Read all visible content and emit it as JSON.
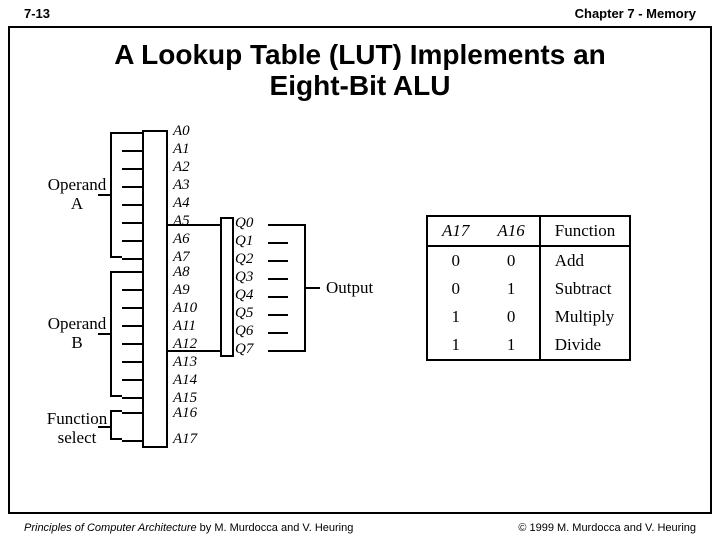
{
  "header": {
    "page_num": "7-13",
    "chapter": "Chapter 7 - Memory"
  },
  "title_line1": "A Lookup Table (LUT) Implements an",
  "title_line2": "Eight-Bit ALU",
  "inputs": {
    "operand_a": {
      "label": "Operand\nA",
      "bits": [
        "A0",
        "A1",
        "A2",
        "A3",
        "A4",
        "A5",
        "A6",
        "A7"
      ]
    },
    "operand_b": {
      "label": "Operand\nB",
      "bits": [
        "A8",
        "A9",
        "A10",
        "A11",
        "A12",
        "A13",
        "A14",
        "A15"
      ]
    },
    "function_select": {
      "label": "Function\nselect",
      "bits": [
        "A16",
        "A17"
      ]
    }
  },
  "outputs": {
    "label": "Output",
    "bits": [
      "Q0",
      "Q1",
      "Q2",
      "Q3",
      "Q4",
      "Q5",
      "Q6",
      "Q7"
    ]
  },
  "function_table": {
    "headers": [
      "A17",
      "A16",
      "Function"
    ],
    "rows": [
      [
        "0",
        "0",
        "Add"
      ],
      [
        "0",
        "1",
        "Subtract"
      ],
      [
        "1",
        "0",
        "Multiply"
      ],
      [
        "1",
        "1",
        "Divide"
      ]
    ]
  },
  "footer": {
    "book": "Principles of Computer Architecture",
    "authors": " by M. Murdocca and V. Heuring",
    "copyright": "© 1999 M. Murdocca and V. Heuring"
  }
}
